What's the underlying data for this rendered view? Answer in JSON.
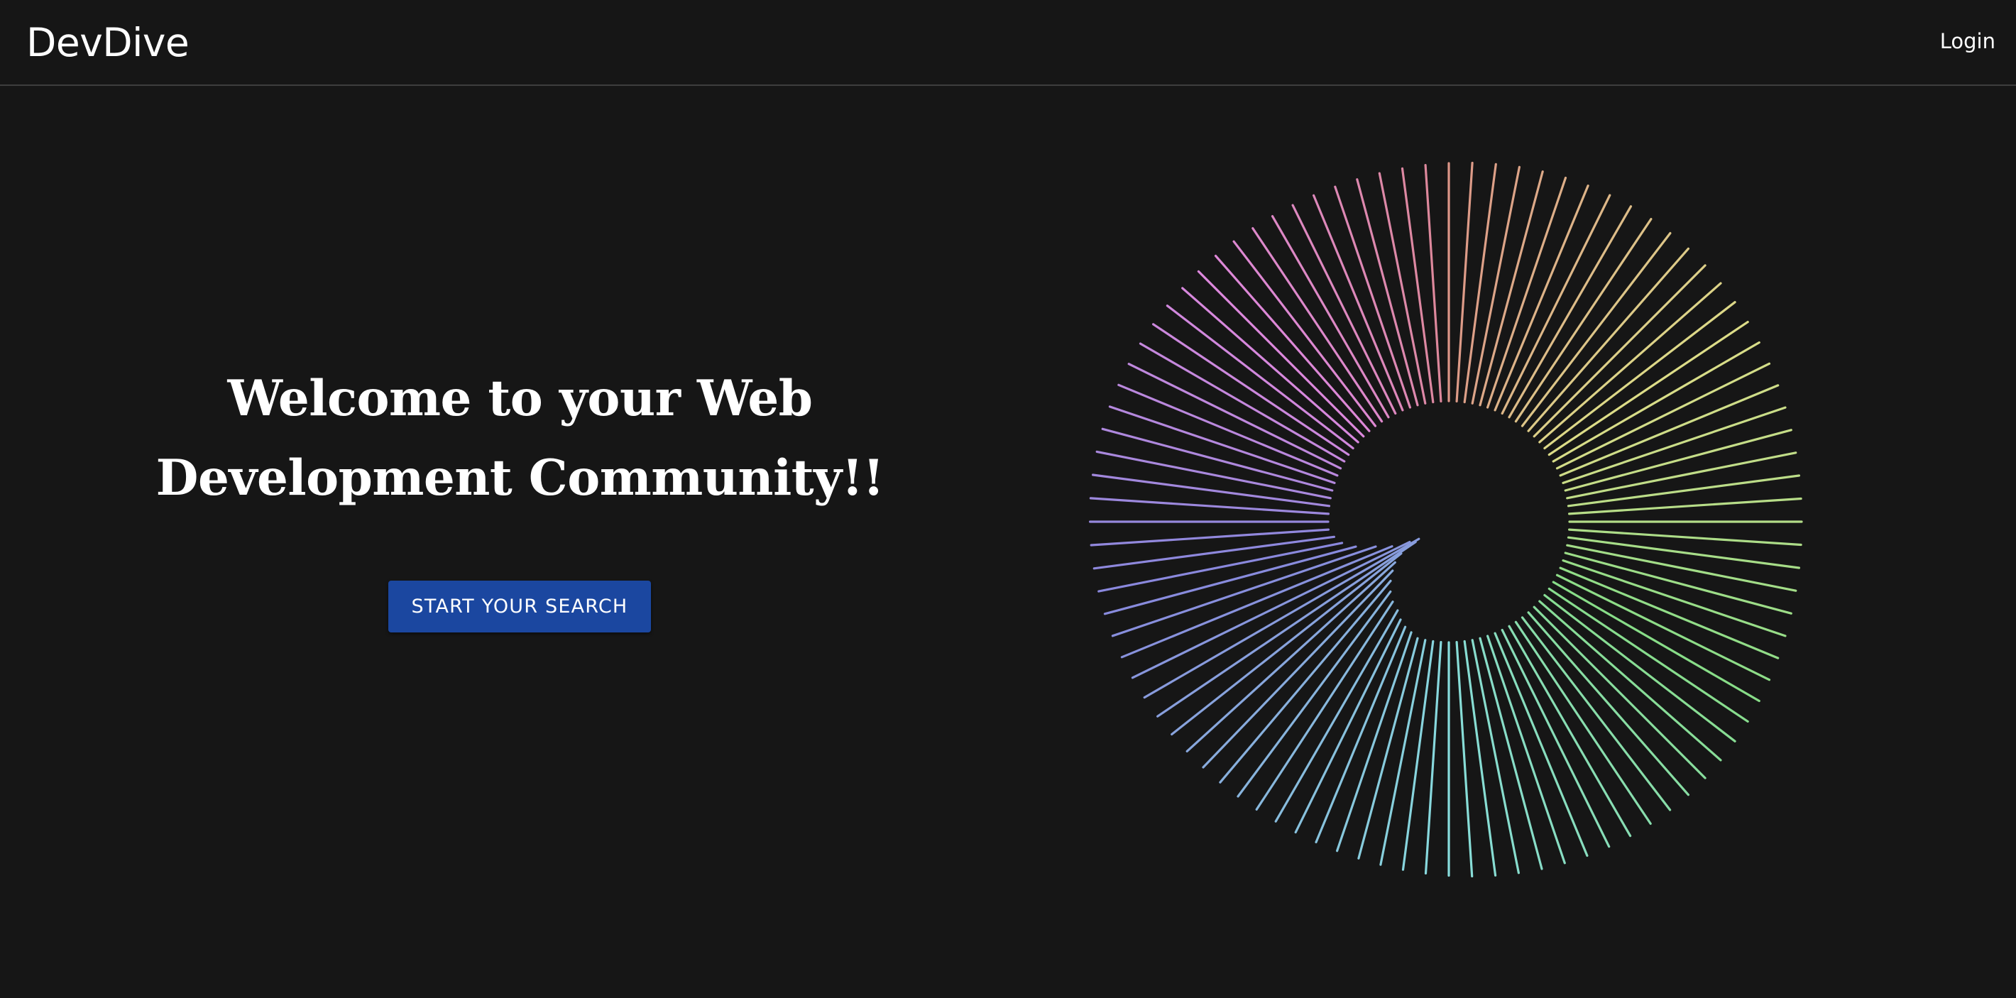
{
  "nav": {
    "brand": "DevDive",
    "login_label": "Login"
  },
  "hero": {
    "headline_line1": "Welcome to your Web",
    "headline_line2": "Development Community!!",
    "cta_label": "START YOUR SEARCH"
  },
  "colors": {
    "background": "#161616",
    "cta": "#1b47a0",
    "nav_border": "#3e3e3e",
    "text": "#ffffff"
  }
}
